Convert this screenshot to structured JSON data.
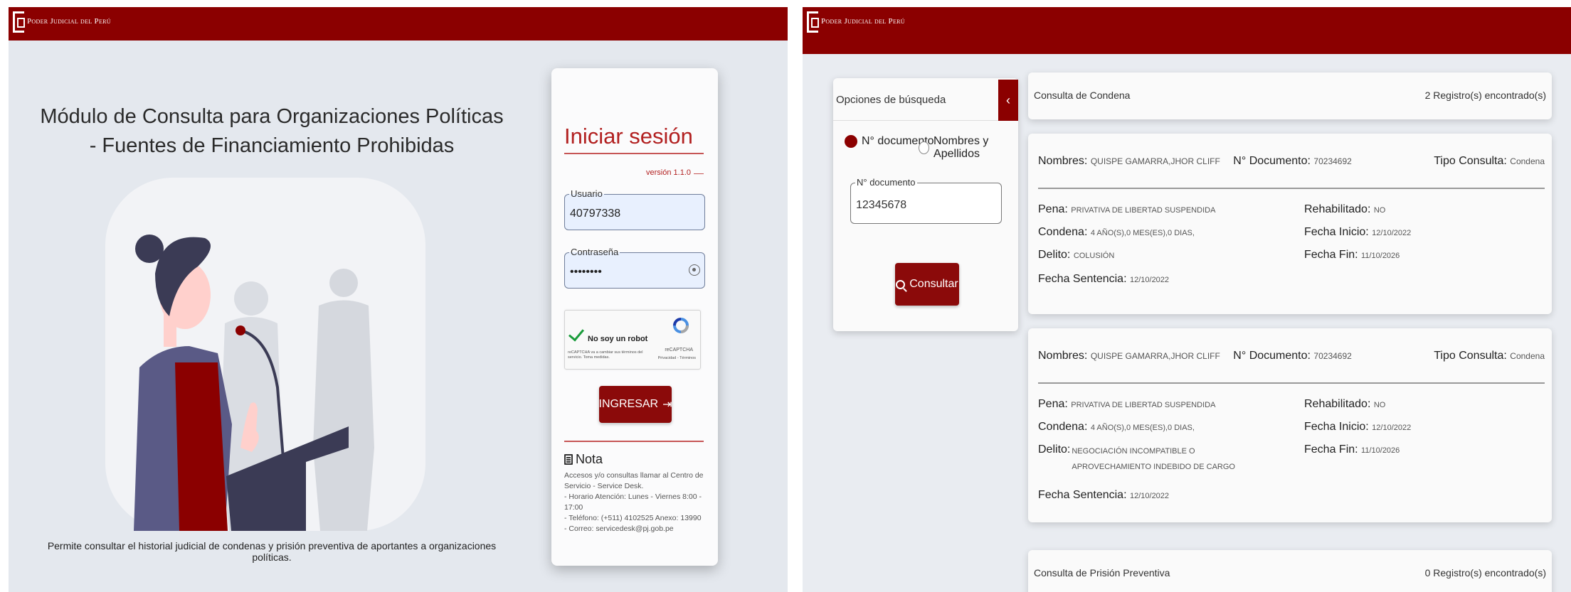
{
  "brand": {
    "text": "Poder Judicial del Perú"
  },
  "login": {
    "module_title": "Módulo de Consulta para Organizaciones Políticas - Fuentes de Financiamiento Prohibidas",
    "description": "Permite consultar el historial judicial de condenas y prisión preventiva de aportantes a organizaciones políticas.",
    "title": "Iniciar sesión",
    "version": "versión 1.1.0",
    "user_label": "Usuario",
    "user_value": "40797338",
    "password_label": "Contraseña",
    "password_value": "••••••••",
    "captcha": {
      "label": "No soy un robot",
      "note": "reCAPTCHA va a cambiar sus términos del servicio. Toma medidas.",
      "brand": "reCAPTCHA",
      "privacy": "Privacidad - Términos"
    },
    "submit_label": "INGRESAR",
    "note_title": "Nota",
    "note_lines": [
      "Accesos y/o consultas llamar al Centro de Servicio - Service Desk.",
      "- Horario Atención: Lunes - Viernes 8:00 - 17:00",
      "- Teléfono: (+511) 4102525 Anexo: 13990",
      "- Correo: servicedesk@pj.gob.pe"
    ]
  },
  "search": {
    "title": "Opciones de búsqueda",
    "collapse_icon": "chevron-left-icon",
    "radio_doc": "N° documento",
    "radio_names": "Nombres y Apellidos",
    "doc_label": "N° documento",
    "doc_value": "12345678",
    "submit_label": "Consultar"
  },
  "results": {
    "condena_header": "Consulta de Condena",
    "condena_count": "2 Registro(s) encontrado(s)",
    "prision_header": "Consulta de Prisión Preventiva",
    "prision_count": "0 Registro(s) encontrado(s)",
    "labels": {
      "nombres": "Nombres:",
      "documento": "N° Documento:",
      "tipo": "Tipo Consulta:",
      "pena": "Pena:",
      "condena": "Condena:",
      "delito": "Delito:",
      "fecha_sentencia": "Fecha Sentencia:",
      "rehabilitado": "Rehabilitado:",
      "fecha_inicio": "Fecha Inicio:",
      "fecha_fin": "Fecha Fin:"
    },
    "records": [
      {
        "nombres": "QUISPE GAMARRA,JHOR CLIFF",
        "documento": "70234692",
        "tipo": "Condena",
        "pena": "PRIVATIVA DE LIBERTAD SUSPENDIDA",
        "condena": "4 AÑO(S),0 MES(ES),0 DIAS,",
        "delito": "COLUSIÓN",
        "fecha_sentencia": "12/10/2022",
        "rehabilitado": "NO",
        "fecha_inicio": "12/10/2022",
        "fecha_fin": "11/10/2026"
      },
      {
        "nombres": "QUISPE GAMARRA,JHOR CLIFF",
        "documento": "70234692",
        "tipo": "Condena",
        "pena": "PRIVATIVA DE LIBERTAD SUSPENDIDA",
        "condena": "4 AÑO(S),0 MES(ES),0 DIAS,",
        "delito": "NEGOCIACIÓN INCOMPATIBLE O APROVECHAMIENTO INDEBIDO DE CARGO",
        "fecha_sentencia": "12/10/2022",
        "rehabilitado": "NO",
        "fecha_inicio": "12/10/2022",
        "fecha_fin": "11/10/2026"
      }
    ]
  },
  "colors": {
    "brand_red": "#8b0000",
    "accent_red": "#b22020",
    "background": "#e4e8ee"
  }
}
